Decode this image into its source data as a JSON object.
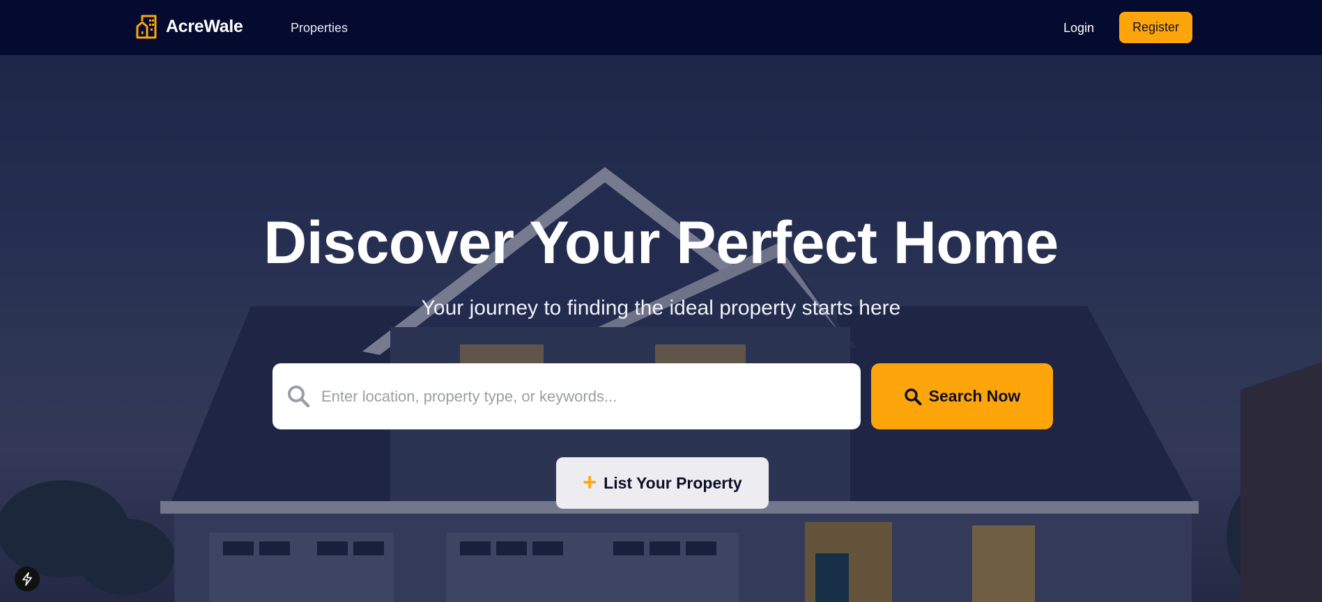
{
  "brand": {
    "name": "AcreWale",
    "icon": "building-icon",
    "accent": "#ffa50c"
  },
  "nav": {
    "links": [
      {
        "label": "Properties"
      }
    ],
    "login_label": "Login",
    "register_label": "Register"
  },
  "hero": {
    "title": "Discover Your Perfect Home",
    "subtitle": "Your journey to finding the ideal property starts here",
    "search": {
      "placeholder": "Enter location, property type, or keywords...",
      "value": "",
      "button_label": "Search Now"
    },
    "list_button_label": "List Your Property"
  },
  "colors": {
    "navbar_bg": "#050b2e",
    "accent": "#ffa50c",
    "text_dark": "#0c0f28"
  },
  "icons": [
    "building-icon",
    "search-icon",
    "plus-icon",
    "lightning-icon"
  ]
}
